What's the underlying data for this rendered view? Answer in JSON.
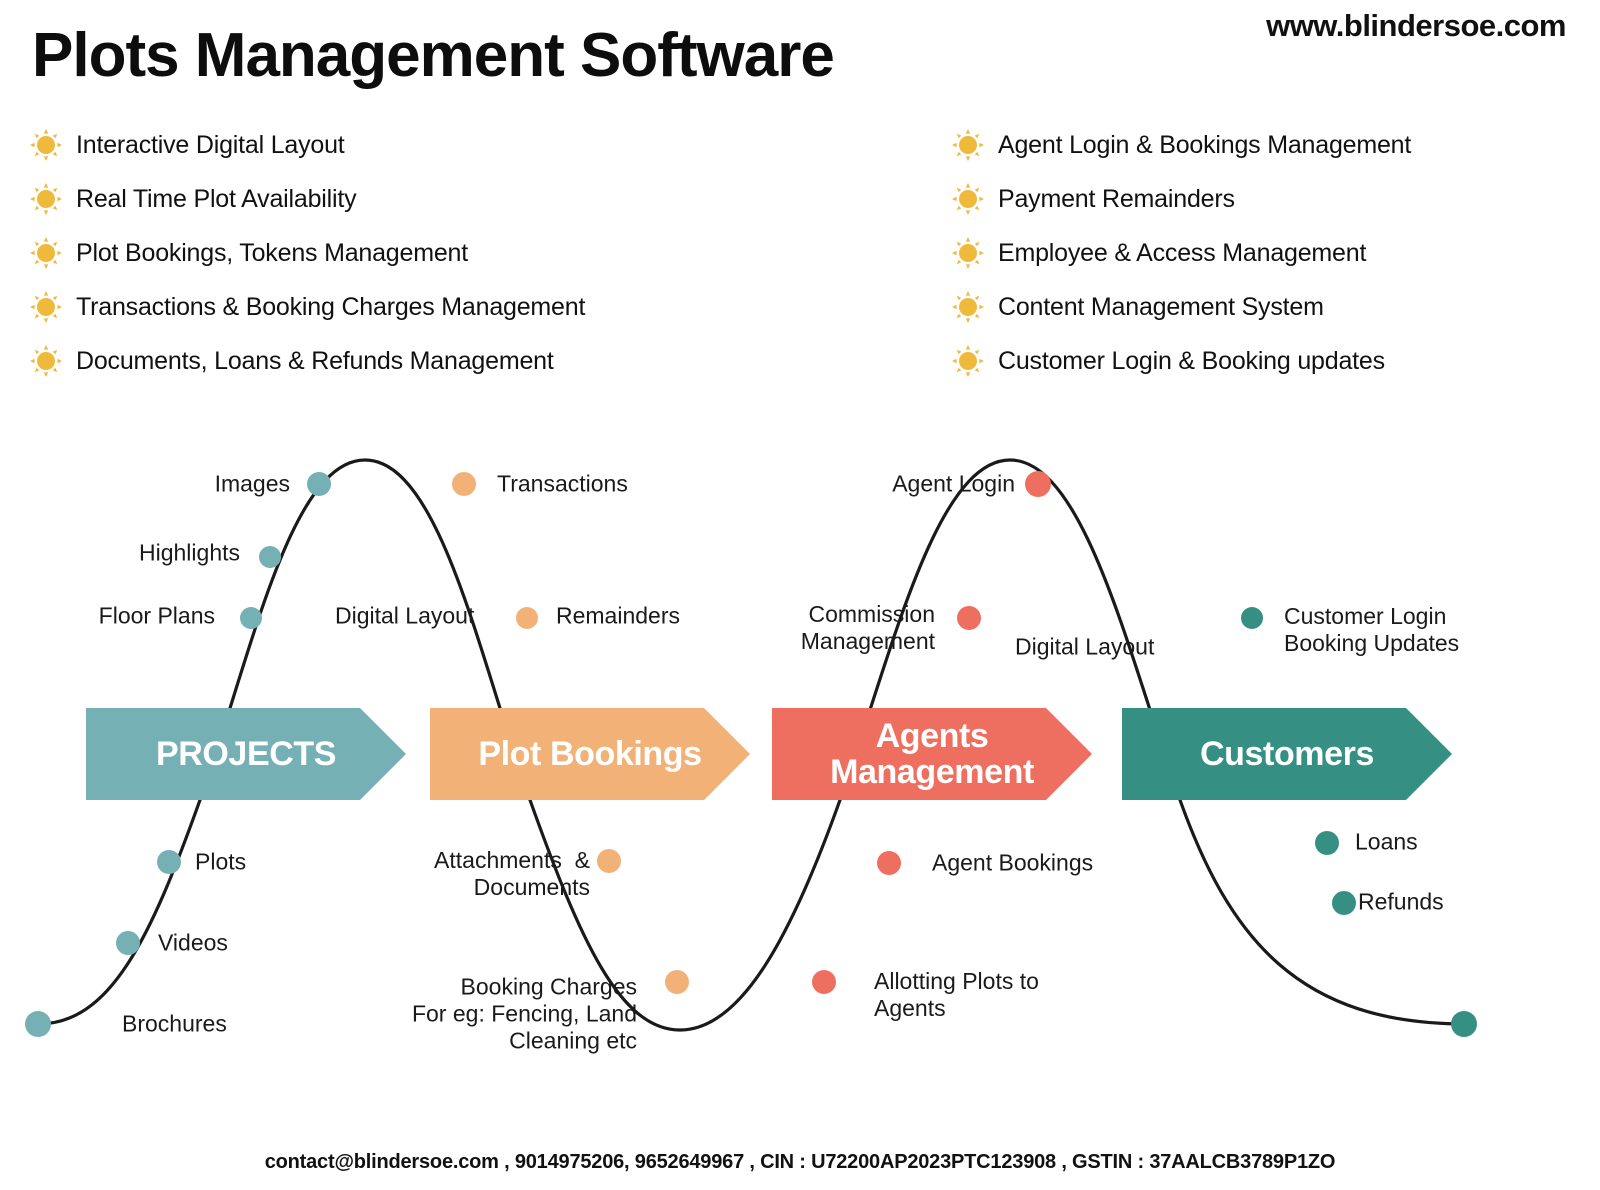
{
  "header": {
    "title": "Plots Management Software",
    "website": "www.blindersoe.com"
  },
  "features": {
    "bullet_icon": "sun-icon",
    "bullet_color": "#efb93b",
    "left": [
      "Interactive Digital Layout",
      "Real Time Plot Availability",
      "Plot Bookings, Tokens Management",
      "Transactions & Booking Charges Management",
      "Documents, Loans & Refunds Management"
    ],
    "right": [
      "Agent Login & Bookings Management",
      "Payment Remainders",
      "Employee & Access Management",
      "Content Management System",
      "Customer Login & Booking updates"
    ]
  },
  "diagram": {
    "curve_color": "#1a1a1a",
    "stages": [
      {
        "name": "projects",
        "banner_label": "PROJECTS",
        "color": "#74b0b4",
        "nodes": [
          "Images",
          "Highlights",
          "Floor Plans",
          "Digital Layout",
          "Plots",
          "Videos",
          "Brochures"
        ]
      },
      {
        "name": "plot-bookings",
        "banner_label": "Plot Bookings",
        "color": "#f2b277",
        "nodes": [
          "Transactions",
          "Remainders",
          "Attachments  &\nDocuments",
          "Booking Charges\nFor eg: Fencing, Land\nCleaning etc"
        ]
      },
      {
        "name": "agents-management",
        "banner_label": "Agents\nManagement",
        "color": "#ee6f5f",
        "nodes": [
          "Agent Login",
          "Commission\nManagement",
          "Digital Layout",
          "Agent Bookings",
          "Allotting Plots to\nAgents"
        ]
      },
      {
        "name": "customers",
        "banner_label": "Customers",
        "color": "#359083",
        "nodes": [
          "Customer Login\nBooking Updates",
          "Loans",
          "Refunds"
        ]
      }
    ],
    "labels": {
      "images": "Images",
      "highlights": "Highlights",
      "floor_plans": "Floor Plans",
      "digital_layout_1": "Digital Layout",
      "plots": "Plots",
      "videos": "Videos",
      "brochures": "Brochures",
      "transactions": "Transactions",
      "remainders": "Remainders",
      "attachments_documents": "Attachments  &\nDocuments",
      "booking_charges": "Booking Charges\nFor eg: Fencing, Land\nCleaning etc",
      "agent_login": "Agent Login",
      "commission_management": "Commission\nManagement",
      "digital_layout_2": "Digital Layout",
      "agent_bookings": "Agent Bookings",
      "allotting_plots": "Allotting Plots to\nAgents",
      "customer_login_booking": "Customer Login\nBooking Updates",
      "loans": "Loans",
      "refunds": "Refunds"
    },
    "banners": {
      "projects": "PROJECTS",
      "plot_bookings": "Plot Bookings",
      "agents_management": "Agents\nManagement",
      "customers": "Customers"
    }
  },
  "footer": {
    "contact": "contact@blindersoe.com , 9014975206, 9652649967 , CIN : U72200AP2023PTC123908 , GSTIN : 37AALCB3789P1ZO"
  }
}
